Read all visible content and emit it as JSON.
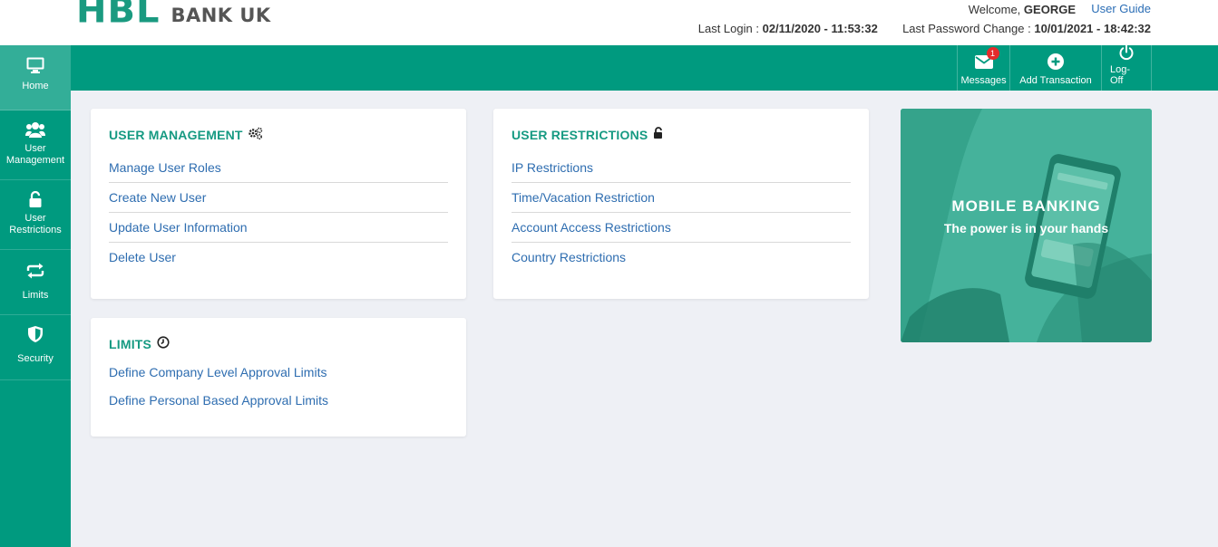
{
  "header": {
    "logo_mark": "HBL",
    "logo_text": "BANK UK",
    "welcome_prefix": "Welcome,",
    "user_name": "GEORGE",
    "user_guide": "User Guide",
    "last_login_label": "Last Login :",
    "last_login_value": "02/11/2020 - 11:53:32",
    "last_password_label": "Last Password Change :",
    "last_password_value": "10/01/2021 - 18:42:32"
  },
  "topbar": {
    "actions": [
      {
        "label": "Messages",
        "icon": "envelope-icon",
        "badge": "1"
      },
      {
        "label": "Add Transaction",
        "icon": "plus-circle-icon"
      },
      {
        "label": "Log-Off",
        "icon": "power-icon"
      }
    ]
  },
  "sidebar": {
    "items": [
      {
        "label": "Home",
        "icon": "monitor-icon",
        "active": true
      },
      {
        "label": "User Management",
        "icon": "users-icon"
      },
      {
        "label": "User Restrictions",
        "icon": "lock-icon"
      },
      {
        "label": "Limits",
        "icon": "exchange-icon"
      },
      {
        "label": "Security",
        "icon": "shield-icon"
      }
    ]
  },
  "cards": {
    "user_management": {
      "title": "USER MANAGEMENT",
      "icon": "gears-icon",
      "links": [
        "Manage User Roles",
        "Create New User",
        "Update User Information",
        "Delete User"
      ]
    },
    "user_restrictions": {
      "title": "USER RESTRICTIONS",
      "icon": "unlock-icon",
      "links": [
        "IP Restrictions",
        "Time/Vacation Restriction",
        "Account Access Restrictions",
        "Country Restrictions"
      ]
    },
    "limits": {
      "title": "LIMITS",
      "icon": "clock-icon",
      "links": [
        "Define Company Level Approval Limits",
        "Define Personal Based Approval Limits"
      ]
    }
  },
  "banner": {
    "title": "MOBILE BANKING",
    "subtitle": "The power is in your hands"
  },
  "colors": {
    "brand_green": "#009a7f",
    "link_blue": "#2e6db0",
    "badge_red": "#e52b2b",
    "background": "#eef0f5"
  }
}
